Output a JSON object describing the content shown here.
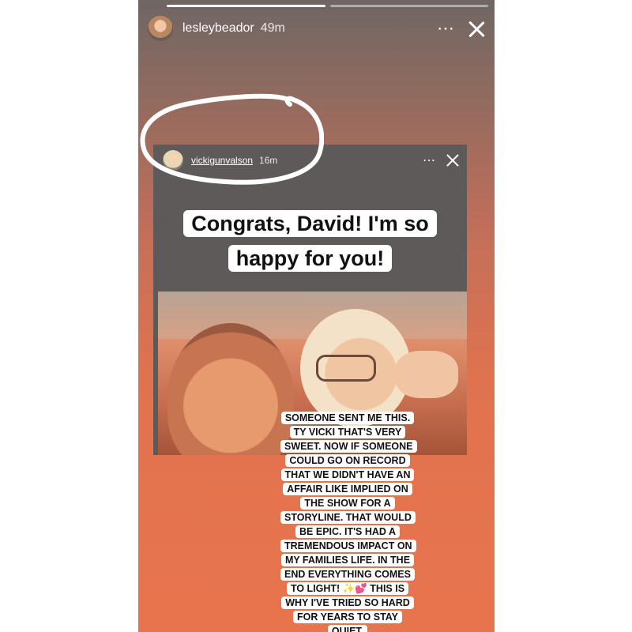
{
  "story": {
    "username": "lesleybeador",
    "time": "49m",
    "more_icon": "⋯",
    "close_icon": "close-icon",
    "progress_segments": 2,
    "active_segment": 0
  },
  "repost": {
    "username": "vickigunvalson",
    "time": "16m",
    "more_icon": "⋯",
    "caption": "Congrats, David! I'm so happy for you!",
    "highlight_color": "#ffffff"
  },
  "overlay_text": "SOMEONE SENT ME THIS. TY VICKI THAT'S VERY SWEET. NOW IF SOMEONE COULD GO ON RECORD THAT WE DIDN'T HAVE AN AFFAIR LIKE IMPLIED ON THE SHOW FOR A STORYLINE. THAT WOULD BE EPIC. IT'S HAD A TREMENDOUS IMPACT ON MY FAMILIES LIFE. IN THE END EVERYTHING COMES TO LIGHT! ✨💕 THIS IS WHY I'VE TRIED SO HARD FOR YEARS TO STAY QUIET."
}
